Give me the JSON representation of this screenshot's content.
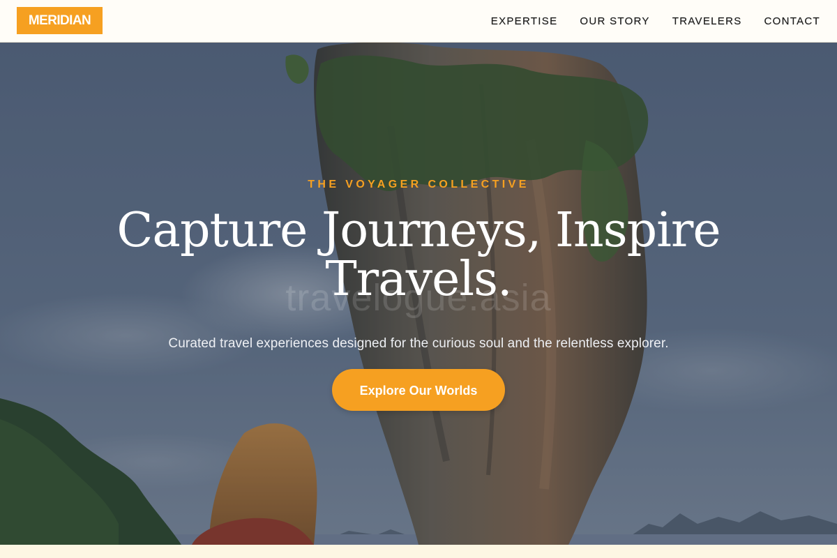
{
  "brand": {
    "logo_text": "MERIDIAN",
    "accent_color": "#f6a021"
  },
  "nav": {
    "items": [
      {
        "label": "EXPERTISE"
      },
      {
        "label": "OUR STORY"
      },
      {
        "label": "TRAVELERS"
      },
      {
        "label": "CONTACT"
      }
    ]
  },
  "hero": {
    "eyebrow": "THE VOYAGER COLLECTIVE",
    "headline": "Capture Journeys, Inspire Travels.",
    "subheadline": "Curated travel experiences designed for the curious soul and the relentless explorer.",
    "cta_label": "Explore Our Worlds",
    "watermark": "travelogue.asia",
    "background_image": "limestone-sea-stack-with-traveler"
  }
}
